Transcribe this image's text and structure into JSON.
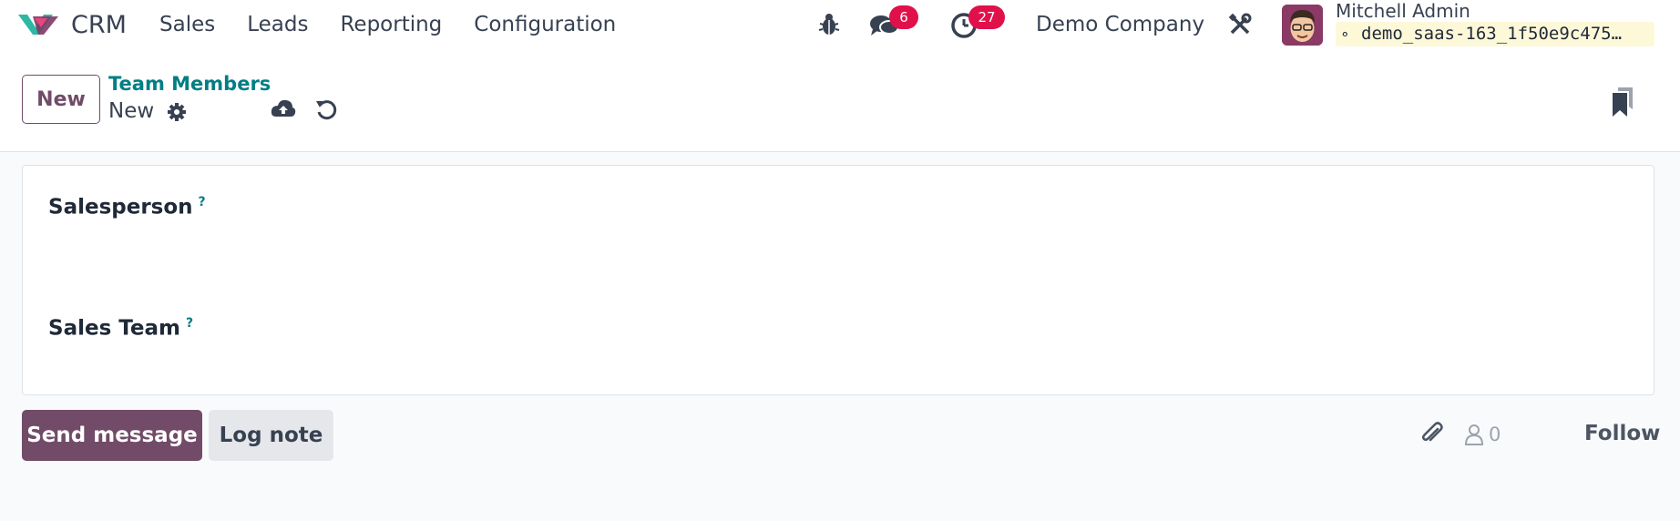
{
  "navbar": {
    "app_name": "CRM",
    "menu": [
      "Sales",
      "Leads",
      "Reporting",
      "Configuration"
    ],
    "messages_count": "6",
    "activities_count": "27",
    "company": "Demo Company",
    "user_name": "Mitchell Admin",
    "database": "demo_saas-163_1f50e9c475…"
  },
  "control_panel": {
    "new_button": "New",
    "breadcrumb_parent": "Team Members",
    "breadcrumb_current": "New"
  },
  "form": {
    "salesperson_label": "Salesperson",
    "sales_team_label": "Sales Team",
    "help_marker": "?"
  },
  "chatter": {
    "send_message": "Send message",
    "log_note": "Log note",
    "followers_count": "0",
    "follow": "Follow"
  },
  "colors": {
    "primary": "#714b67",
    "link": "#017e84",
    "badge": "#e0104a",
    "db_chip": "#fdf8d8"
  }
}
